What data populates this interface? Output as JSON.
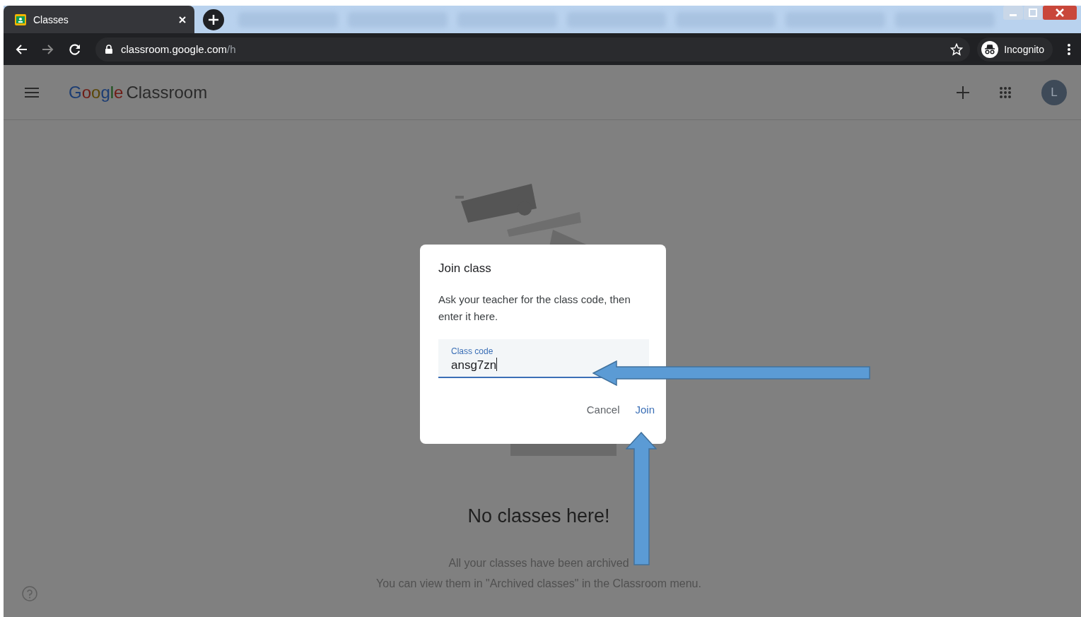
{
  "browser": {
    "active_tab": {
      "title": "Classes"
    },
    "url": {
      "host": "classroom.google.com",
      "path": "/h"
    },
    "profile": "Incognito"
  },
  "app_bar": {
    "logo_brand": "Google",
    "logo_product": "Classroom",
    "avatar_initial": "L"
  },
  "dialog": {
    "title": "Join class",
    "message": "Ask your teacher for the class code, then enter it here.",
    "field": {
      "label": "Class code",
      "value": "ansg7zn"
    },
    "buttons": [
      {
        "label": "Cancel",
        "kind": "text"
      },
      {
        "label": "Join",
        "kind": "primary"
      }
    ]
  },
  "empty_state": {
    "heading": "No classes here!",
    "lines": [
      "All your classes have been archived",
      "You can view them in \"Archived classes\" in the Classroom menu."
    ]
  }
}
